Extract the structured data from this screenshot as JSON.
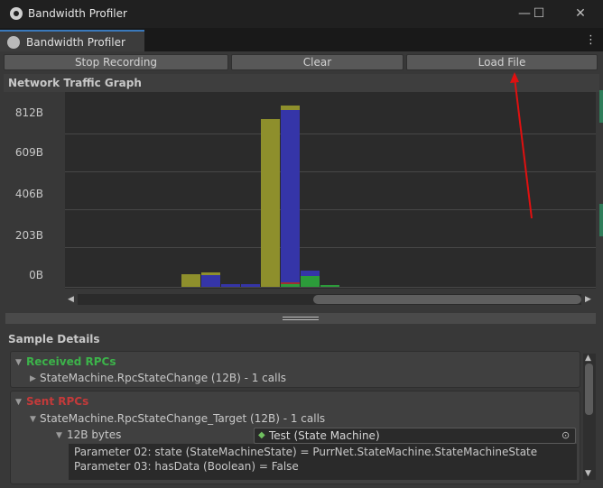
{
  "window": {
    "title": "Bandwidth Profiler",
    "minimize_glyph": "—",
    "maximize_glyph": "☐",
    "close_glyph": "✕"
  },
  "tab": {
    "label": "Bandwidth Profiler",
    "menu_glyph": "⋮"
  },
  "toolbar": {
    "stop_label": "Stop Recording",
    "clear_label": "Clear",
    "load_label": "Load File"
  },
  "graph": {
    "title": "Network Traffic Graph",
    "y_ticks": [
      "812B",
      "609B",
      "406B",
      "203B",
      "0B"
    ]
  },
  "chart_data": {
    "type": "bar",
    "ylabel": "",
    "ylim": [
      0,
      900
    ],
    "ticks": [
      812,
      609,
      406,
      203,
      0
    ],
    "series_colors": {
      "olive": "#8e8f2c",
      "blue": "#3535a8",
      "green": "#2c9b3a",
      "red": "#a03030"
    },
    "samples": [
      {
        "stack": [
          {
            "value": 65,
            "color": "olive"
          }
        ]
      },
      {
        "stack": [
          {
            "value": 60,
            "color": "blue"
          },
          {
            "value": 12,
            "color": "olive"
          }
        ]
      },
      {
        "stack": [
          {
            "value": 12,
            "color": "blue"
          }
        ]
      },
      {
        "stack": [
          {
            "value": 12,
            "color": "blue"
          }
        ]
      },
      {
        "stack": [
          {
            "value": 890,
            "color": "olive"
          }
        ]
      },
      {
        "stack": [
          {
            "value": 12,
            "color": "green"
          },
          {
            "value": 10,
            "color": "red"
          },
          {
            "value": 910,
            "color": "blue"
          },
          {
            "value": 25,
            "color": "olive"
          }
        ]
      },
      {
        "stack": [
          {
            "value": 55,
            "color": "green"
          },
          {
            "value": 28,
            "color": "blue"
          }
        ]
      },
      {
        "stack": [
          {
            "value": 4,
            "color": "green"
          }
        ]
      }
    ]
  },
  "details": {
    "title": "Sample Details",
    "received": {
      "header": "Received RPCs",
      "color": "#3cb34a",
      "item": "StateMachine.RpcStateChange (12B) - 1 calls"
    },
    "sent": {
      "header": "Sent RPCs",
      "color": "#c43a3a",
      "item": "StateMachine.RpcStateChange_Target (12B) - 1 calls",
      "bytes_label": "12B bytes",
      "object_field": "Test (State Machine)",
      "params": [
        "Parameter 02: state (StateMachineState) = PurrNet.StateMachine.StateMachineState",
        "Parameter 03: hasData (Boolean) = False"
      ]
    }
  }
}
